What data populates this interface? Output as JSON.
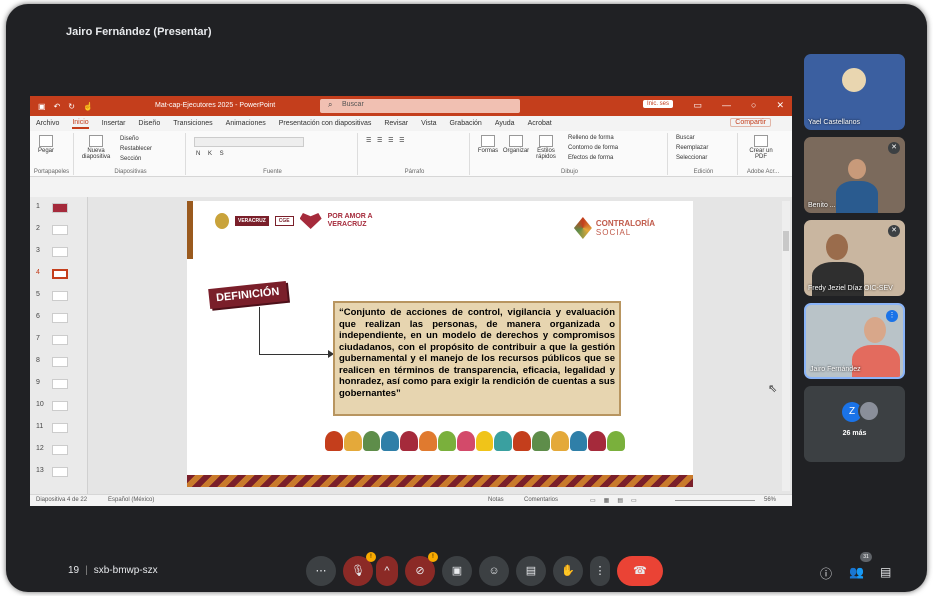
{
  "meet": {
    "presenter_label": "Jairo Fernández (Presentar)",
    "meeting_code_prefix": "19",
    "meeting_code": "sxb-bmwp-szx",
    "participant_count_badge": "31",
    "control_badge": "!",
    "participants": [
      {
        "name": "Yael Castellanos"
      },
      {
        "name": "Benito ..."
      },
      {
        "name": "Fredy Jeziel Díaz OIC-SEV"
      },
      {
        "name": "Jairo Fernández"
      }
    ],
    "more_initial": "Z",
    "more_label": "26 más",
    "colors": {
      "end_call": "#ea4335",
      "accent": "#1a73e8",
      "badge": "#f9ab00"
    }
  },
  "ppt": {
    "title": "Mat-cap-Ejecutores 2025 - PowerPoint",
    "search_placeholder": "Buscar",
    "sign_in": "Inic. ses",
    "tabs": [
      "Archivo",
      "Inicio",
      "Insertar",
      "Diseño",
      "Transiciones",
      "Animaciones",
      "Presentación con diapositivas",
      "Revisar",
      "Vista",
      "Grabación",
      "Ayuda",
      "Acrobat"
    ],
    "share_label": "Compartir",
    "ribbon": {
      "paste": "Pegar",
      "clipboard": "Portapapeles",
      "new_slide": "Nueva diapositiva",
      "layout": "Diseño",
      "reset": "Restablecer",
      "section": "Sección",
      "slides_group": "Diapositivas",
      "font_group": "Fuente",
      "paragraph_group": "Párrafo",
      "shapes": "Formas",
      "arrange": "Organizar",
      "quick_styles": "Estilos rápidos",
      "shape_fill": "Relleno de forma",
      "shape_outline": "Contorno de forma",
      "shape_effects": "Efectos de forma",
      "drawing_group": "Dibujo",
      "find": "Buscar",
      "replace": "Reemplazar",
      "select": "Seleccionar",
      "editing_group": "Edición",
      "create_pdf": "Crear un PDF",
      "adobe_group": "Adobe Acr..."
    },
    "slide_numbers": [
      "1",
      "2",
      "3",
      "4",
      "5",
      "6",
      "7",
      "8",
      "9",
      "10",
      "11",
      "12",
      "13"
    ],
    "selected_slide": 4,
    "status": {
      "slide_info": "Diapositiva 4 de 22",
      "language": "Español (México)",
      "notes": "Notas",
      "comments": "Comentarios",
      "zoom": "56%"
    }
  },
  "slide": {
    "logo_state": "VERACRUZ",
    "logo_cge": "CGE",
    "logo_amor_top": "POR AMOR A",
    "logo_amor_bottom": "VERACRUZ",
    "cs_line1": "CONTRALORÍA",
    "cs_line2": "SOCIAL",
    "definition_label": "DEFINICIÓN",
    "quote": "“Conjunto de acciones de control, vigilancia y evaluación que realizan las personas, de manera organizada o independiente, en un modelo de derechos y compromisos ciudadanos, con el propósito de contribuir a que la gestión gubernamental y el manejo de los recursos públicos que se realicen en términos de transparencia, eficacia, legalidad y honradez, así como para exigir la rendición de cuentas a sus gobernantes”"
  }
}
